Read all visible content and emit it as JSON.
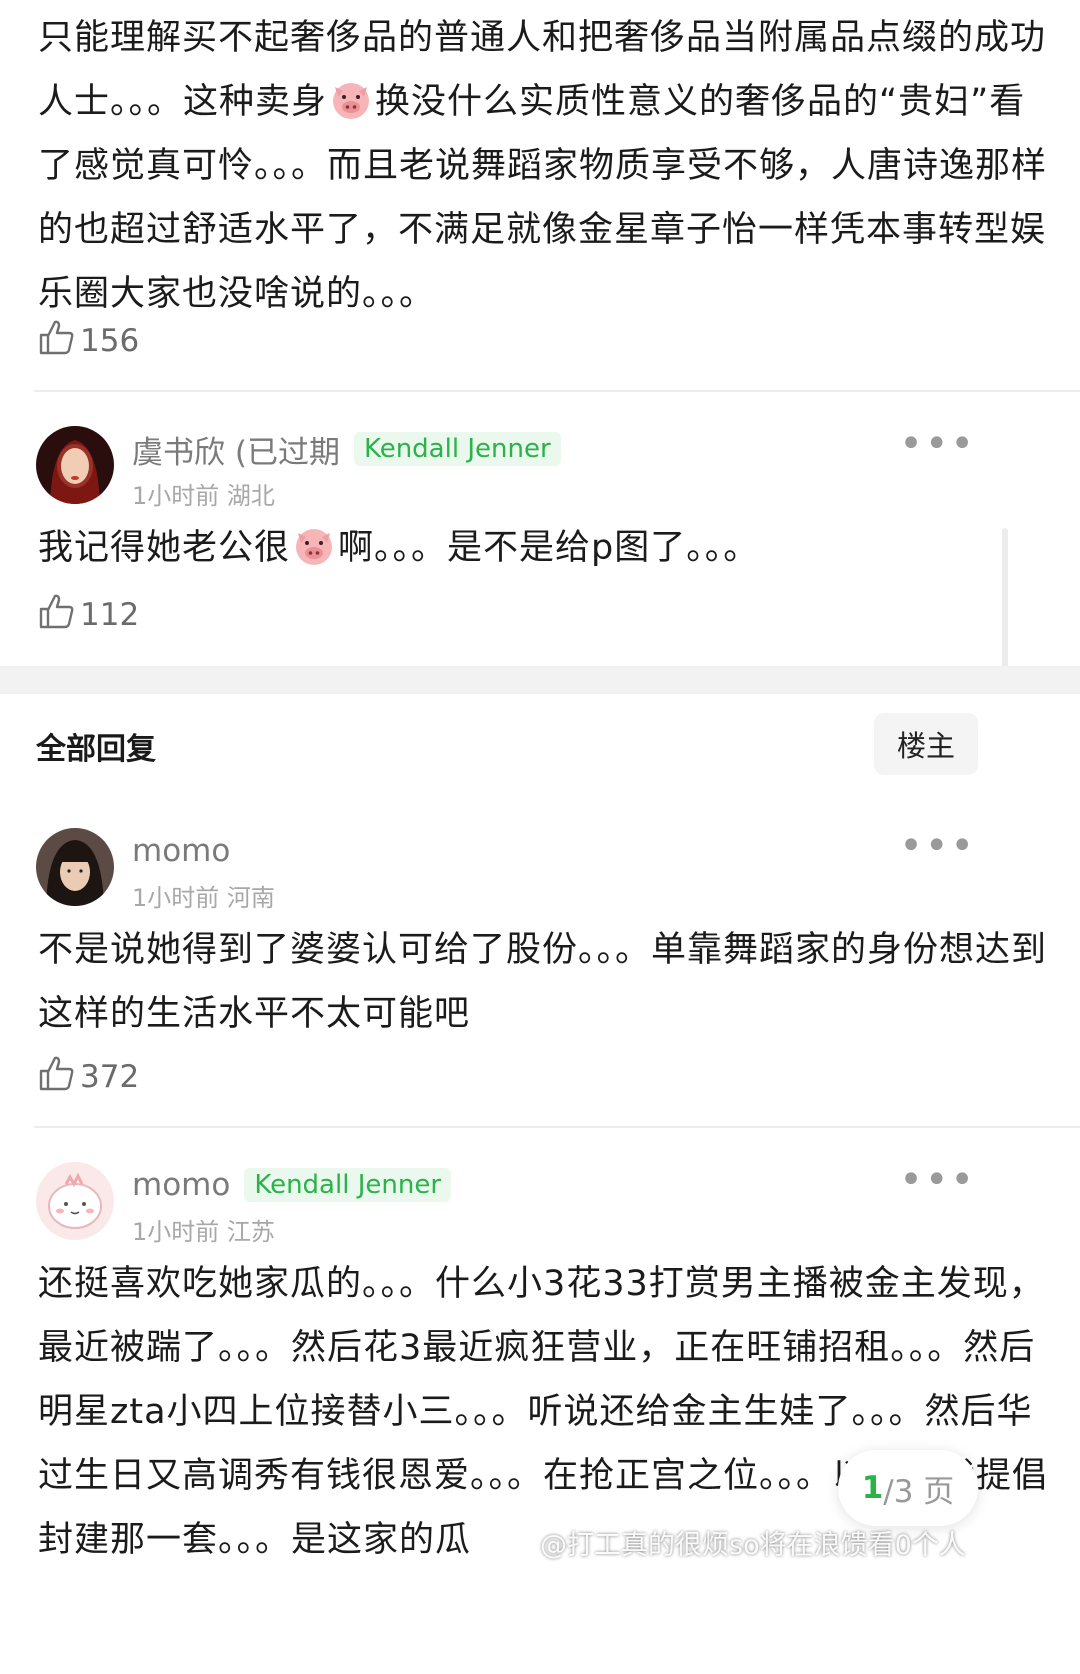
{
  "comment_top": {
    "text_before_pig": "只能理解买不起奢侈品的普通人和把奢侈品当附属品点缀的成功人士。。。这种卖身",
    "text_after_pig": "换没什么实质性意义的奢侈品的“贵妇”看了感觉真可怜。。。而且老说舞蹈家物质享受不够，人唐诗逸那样的也超过舒适水平了，不满足就像金星章子怡一样凭本事转型娱乐圈大家也没啥说的。。。",
    "likes": "156"
  },
  "comment_1": {
    "username": "虞书欣 (已过期",
    "badge": "Kendall Jenner",
    "time_location": "1小时前 湖北",
    "text_before_pig": "我记得她老公很",
    "text_after_pig": "啊。。。是不是给p图了。。。",
    "likes": "112"
  },
  "replies_header": {
    "title": "全部回复",
    "owner_button": "楼主"
  },
  "reply_1": {
    "username": "momo",
    "time_location": "1小时前 河南",
    "text": "不是说她得到了婆婆认可给了股份。。。单靠舞蹈家的身份想达到这样的生活水平不太可能吧",
    "likes": "372"
  },
  "reply_2": {
    "username": "momo",
    "badge": "Kendall Jenner",
    "time_location": "1小时前 江苏",
    "text": "还挺喜欢吃她家瓜的。。。什么小3花33打赏男主播被金主发现，最近被踹了。。。然后花3最近疯狂营业，正在旺铺招租。。。然后明星zta小四上位接替小三。。。听说还给金主生娃了。。。然后华过生日又高调秀有钱很恩爱。。。在抢正宫之位。。。以上非我提倡封建那一套。。。是这家的瓜",
    "likes": ""
  },
  "more_symbol": "•••",
  "pager": {
    "current": "1",
    "total_label": "/3 页"
  },
  "watermark": "@打工真的很烦so将在浪馈看0个人",
  "icons": [
    "thumbs-up-icon",
    "pig-emoji-icon",
    "more-icon"
  ],
  "colors": {
    "accent_green": "#2bb34a",
    "badge_bg": "#eaf8ee"
  }
}
